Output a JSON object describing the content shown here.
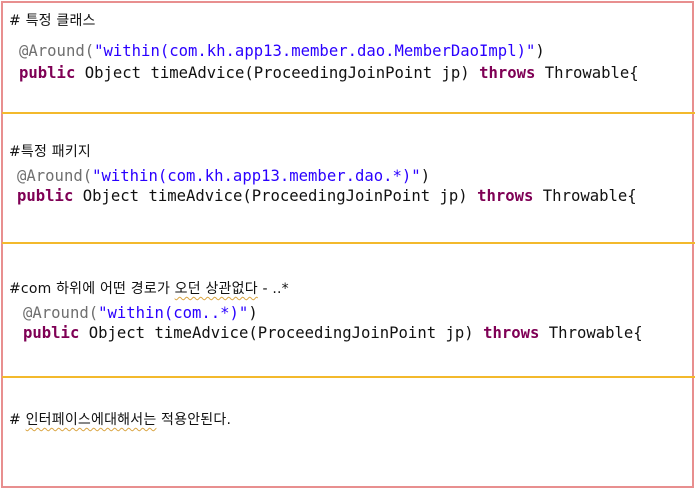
{
  "sections": [
    {
      "note": "# 특정 클래스",
      "annotation": "@Around(",
      "string": "\"within(com.kh.app13.member.dao.MemberDaoImpl)\"",
      "annotation_close": ")",
      "kw_public": "public",
      "sig_mid": " Object timeAdvice(ProceedingJoinPoint ",
      "param": "jp",
      "sig_after_param": ") ",
      "kw_throws": "throws",
      "sig_end": " Throwable{"
    },
    {
      "note": "#특정 패키지",
      "annotation": "@Around(",
      "string": "\"within(com.kh.app13.member.dao.*)\"",
      "annotation_close": ")",
      "kw_public": "public",
      "sig_mid": " Object timeAdvice(ProceedingJoinPoint ",
      "param": "jp",
      "sig_after_param": ") ",
      "kw_throws": "throws",
      "sig_end": " Throwable{"
    },
    {
      "note_plain": "#com 하위에 어떤 경로가 ",
      "note_squiggle": "오던 상관없다",
      "note_tail": " - ..*",
      "annotation": "@Around(",
      "string": "\"within(com..*)\"",
      "annotation_close": ")",
      "kw_public": "public",
      "sig_mid": " Object timeAdvice(ProceedingJoinPoint ",
      "param": "jp",
      "sig_after_param": ") ",
      "kw_throws": "throws",
      "sig_end": " Throwable{"
    },
    {
      "note_plain": "# ",
      "note_squiggle": "인터페이스에대해서는",
      "note_tail": " 적용안된다."
    }
  ],
  "colors": {
    "border": "#e88f8f",
    "divider": "#f3b92c",
    "annotation": "#6f6f6f",
    "string": "#2a00ff",
    "keyword": "#7f0055",
    "squiggle": "#d9a441"
  }
}
